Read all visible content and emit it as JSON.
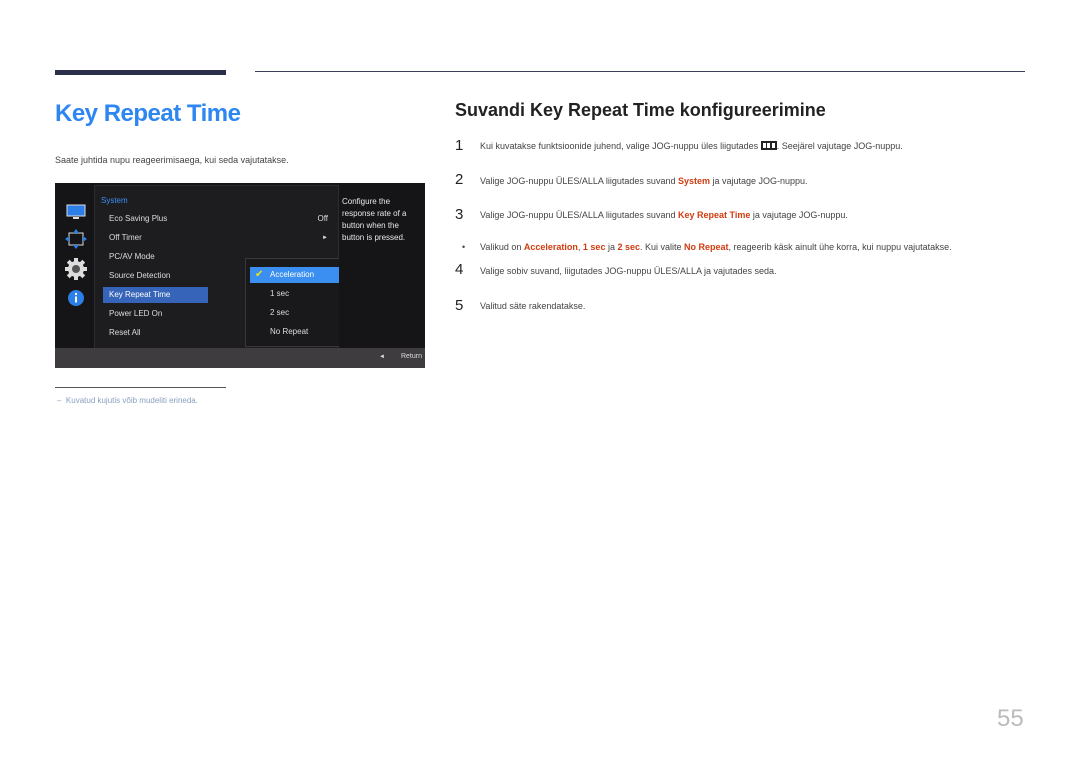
{
  "page": {
    "title": "Key Repeat Time",
    "intro": "Saate juhtida nupu reageerimisaega, kui seda vajutatakse.",
    "note": "Kuvatud kujutis võib mudeliti erineda.",
    "note_dash": "–",
    "page_number": "55"
  },
  "osd": {
    "icons": [
      "monitor-icon",
      "resize-icon",
      "gear-icon",
      "info-icon"
    ],
    "menu_header": "System",
    "menu_items": [
      {
        "label": "Eco Saving Plus",
        "value": "Off"
      },
      {
        "label": "Off Timer",
        "value": "►"
      },
      {
        "label": "PC/AV Mode",
        "value": ""
      },
      {
        "label": "Source Detection",
        "value": ""
      },
      {
        "label": "Key Repeat Time",
        "value": ""
      },
      {
        "label": "Power LED On",
        "value": ""
      },
      {
        "label": "Reset All",
        "value": ""
      }
    ],
    "submenu_items": [
      "Acceleration",
      "1 sec",
      "2 sec",
      "No Repeat"
    ],
    "check": "✔",
    "description": "Configure the response rate of a button when the button is pressed.",
    "return_arrow": "◄",
    "return_label": "Return"
  },
  "instructions": {
    "title": "Suvandi Key Repeat Time konfigureerimine",
    "steps": [
      {
        "num": "1",
        "pre": "Kui kuvatakse funktsioonide juhend, valige JOG-nuppu üles liigutades ",
        "post": ". Seejärel vajutage JOG-nuppu."
      },
      {
        "num": "2",
        "pre": "Valige JOG-nuppu ÜLES/ALLA liigutades suvand ",
        "hl": "System",
        "post": " ja vajutage JOG-nuppu."
      },
      {
        "num": "3",
        "pre": "Valige JOG-nuppu ÜLES/ALLA liigutades suvand ",
        "hl": "Key Repeat Time",
        "post": " ja vajutage JOG-nuppu."
      },
      {
        "num": "4",
        "text": "Valige sobiv suvand, liigutades JOG-nuppu ÜLES/ALLA ja vajutades seda."
      },
      {
        "num": "5",
        "text": "Valitud säte rakendatakse."
      }
    ],
    "bullet": {
      "mark": "•",
      "t1": "Valikud on ",
      "h1": "Acceleration",
      "t2": ", ",
      "h2": "1 sec",
      "t3": " ja ",
      "h3": "2 sec",
      "t4": ". Kui valite ",
      "h4": "No Repeat",
      "t5": ", reageerib käsk ainult ühe korra, kui nuppu vajutatakse."
    }
  }
}
